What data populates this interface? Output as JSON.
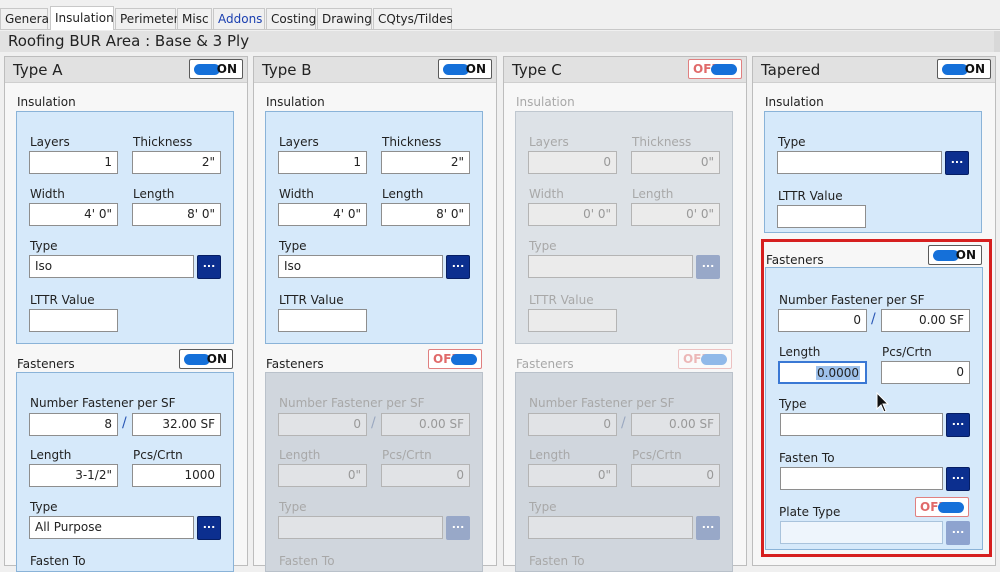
{
  "tabs": [
    "General",
    "Insulation",
    "Perimeter",
    "Misc",
    "Addons",
    "Costing",
    "Drawing",
    "CQtys/Tildes"
  ],
  "window_title": "Roofing BUR Area : Base & 3 Ply",
  "labels": {
    "insulation": "Insulation",
    "fasteners": "Fasteners",
    "layers": "Layers",
    "thickness": "Thickness",
    "width": "Width",
    "length": "Length",
    "type": "Type",
    "lttr": "LTTR Value",
    "num_fastener": "Number Fastener per SF",
    "pcs_crtn": "Pcs/Crtn",
    "fasten_to": "Fasten To",
    "plate_type": "Plate Type",
    "browse": "...",
    "slash": "/"
  },
  "panels": [
    {
      "title": "Type A",
      "toggle": "ON",
      "insulation": {
        "layers": "1",
        "thickness": "2\"",
        "width": "4' 0\"",
        "length": "8' 0\"",
        "type": "Iso",
        "lttr": ""
      },
      "fasteners": {
        "toggle": "ON",
        "num": "8",
        "per_sf": "32.00 SF",
        "length": "3-1/2\"",
        "pcs": "1000",
        "type": "All Purpose"
      }
    },
    {
      "title": "Type B",
      "toggle": "ON",
      "insulation": {
        "layers": "1",
        "thickness": "2\"",
        "width": "4' 0\"",
        "length": "8' 0\"",
        "type": "Iso",
        "lttr": ""
      },
      "fasteners": {
        "toggle": "OFF",
        "num": "0",
        "per_sf": "0.00 SF",
        "length": "0\"",
        "pcs": "0",
        "type": ""
      }
    },
    {
      "title": "Type C",
      "toggle": "OFF",
      "insulation": {
        "layers": "0",
        "thickness": "0\"",
        "width": "0' 0\"",
        "length": "0' 0\"",
        "type": "",
        "lttr": ""
      },
      "fasteners": {
        "toggle": "OFF",
        "num": "0",
        "per_sf": "0.00 SF",
        "length": "0\"",
        "pcs": "0",
        "type": ""
      }
    },
    {
      "title": "Tapered",
      "toggle": "ON",
      "insulation": {
        "type": "",
        "lttr": ""
      },
      "fasteners": {
        "toggle": "ON",
        "num": "0",
        "per_sf": "0.00 SF",
        "length": "0.0000",
        "pcs": "0",
        "type": "",
        "fasten_to": "",
        "plate_toggle": "OFF",
        "plate_type": ""
      }
    }
  ],
  "colors": {
    "accent": "#1570d9",
    "box": "#d6e9fa",
    "button": "#0c2f8f",
    "highlight": "#d61f1f"
  }
}
